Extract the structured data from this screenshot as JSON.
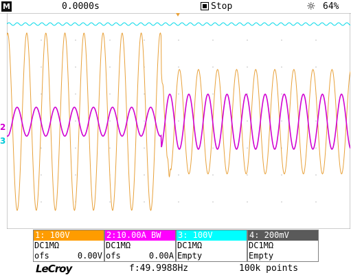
{
  "header": {
    "menu_icon": "M",
    "time_offset": "0.0000s",
    "run_state": "Stop",
    "brightness": "64%",
    "icons": [
      "menu-icon",
      "stop-icon",
      "brightness-icon"
    ]
  },
  "channels": [
    {
      "head": "1: 100V",
      "coupling": "DC1MΩ",
      "line2_left": "ofs",
      "line2_right": "0.00V",
      "color": "#ff9c00",
      "head_text_color": "#ffffff"
    },
    {
      "head": "2:10.00A  BW",
      "coupling": "DC1MΩ",
      "line2_left": "ofs",
      "line2_right": "0.00A",
      "color": "#ff00ff",
      "head_text_color": "#ffffff"
    },
    {
      "head": "3: 100V",
      "coupling": "DC1MΩ",
      "line2_left": "Empty",
      "line2_right": "",
      "color": "#00ffff",
      "head_text_color": "#ffffff"
    },
    {
      "head": "4: 200mV",
      "coupling": "DC1MΩ",
      "line2_left": "Empty",
      "line2_right": "",
      "color": "#5a5a5a",
      "head_text_color": "#ffffff"
    }
  ],
  "markers": {
    "ch2": "2",
    "ch3": "3"
  },
  "footer": {
    "logo": "LeCroy",
    "frequency": "f:49.9988Hz",
    "points": "100k points"
  },
  "waveforms": {
    "ch1": {
      "color": "#e8a13a",
      "frequency_hz": 50,
      "amplitude_before_V": 280,
      "amplitude_after_V": 150,
      "step_time_divs": 5.5
    },
    "ch2": {
      "color": "#d000d0",
      "frequency_hz": 50,
      "amplitude_before_A": 1.2,
      "amplitude_after_A": 2.4
    },
    "ch3": {
      "color": "#00d8e8",
      "state": "flat offset ripple"
    }
  }
}
